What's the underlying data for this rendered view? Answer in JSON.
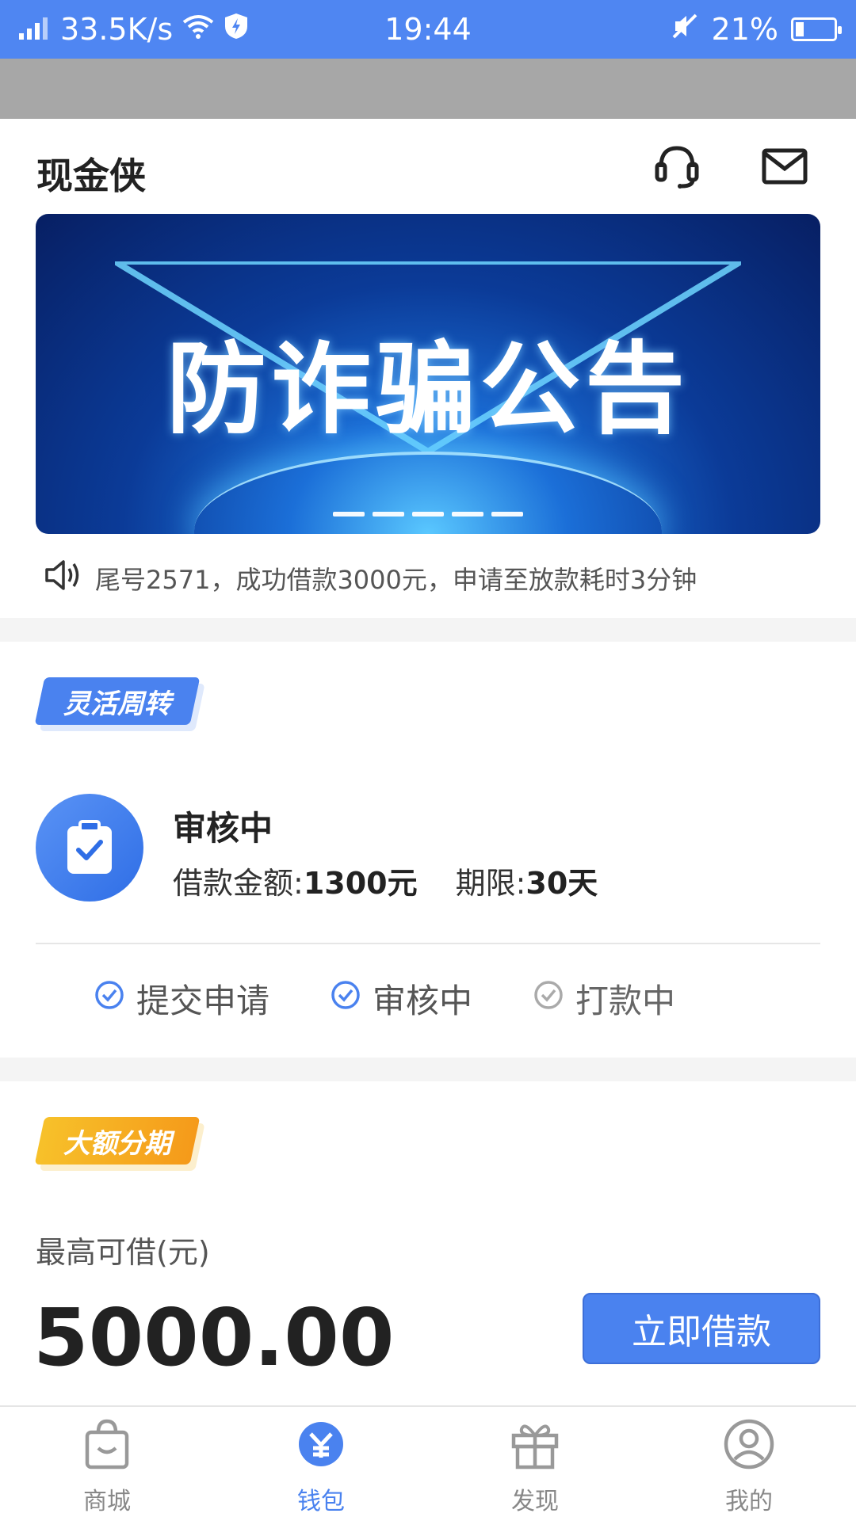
{
  "status_bar": {
    "speed": "33.5K/s",
    "time": "19:44",
    "battery": "21%",
    "battery_level": 0.21
  },
  "header": {
    "title": "现金侠"
  },
  "banner": {
    "headline": "防诈骗公告",
    "page_count": 5
  },
  "notice": {
    "text": "尾号2571，成功借款3000元，申请至放款耗时3分钟"
  },
  "flex_section": {
    "tag": "灵活周转",
    "status": "审核中",
    "amount_label": "借款金额:",
    "amount_value": "1300元",
    "term_label": "期限:",
    "term_value": "30天",
    "steps": [
      "提交申请",
      "审核中",
      "打款中"
    ]
  },
  "large_section": {
    "tag": "大额分期",
    "max_label": "最高可借(元)",
    "max_amount": "5000.00",
    "apply_label": "立即借款"
  },
  "bottom_nav": {
    "items": [
      "商城",
      "钱包",
      "发现",
      "我的"
    ],
    "active": "钱包"
  },
  "colors": {
    "status_bar": "#4f86f2",
    "accent": "#4a82ef",
    "gold": "#f7c12a"
  }
}
